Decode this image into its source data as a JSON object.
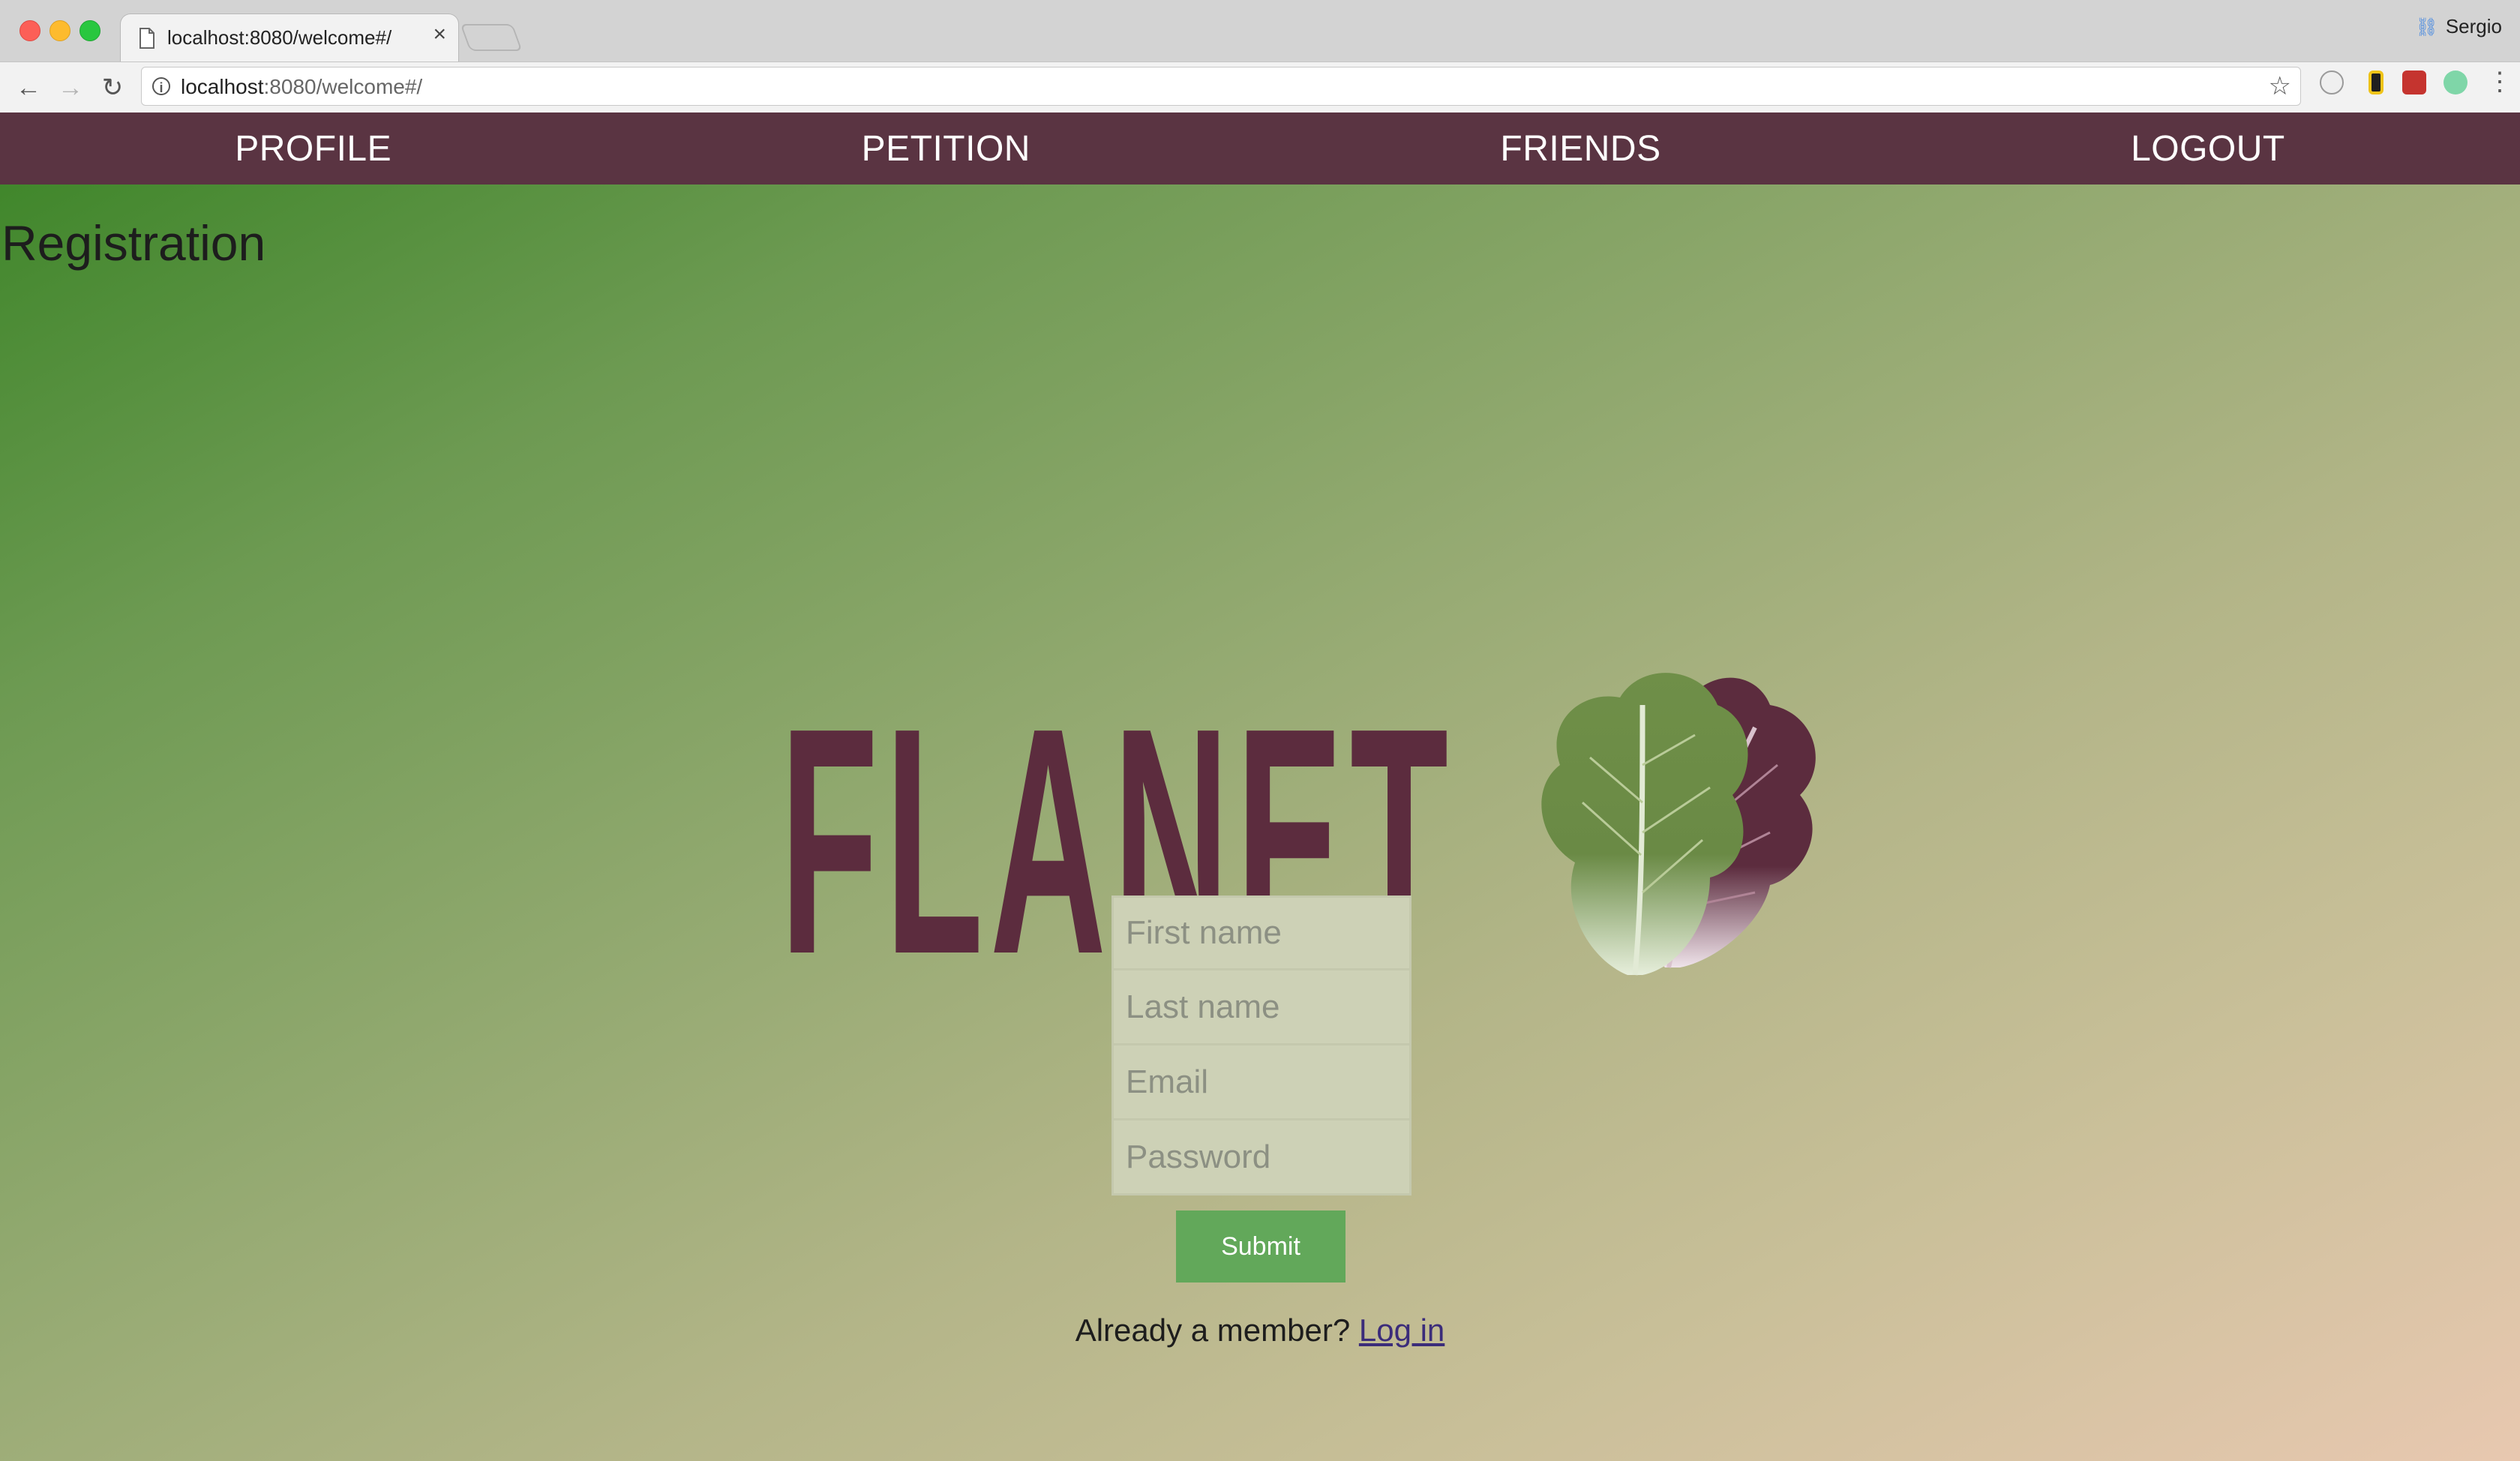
{
  "browser": {
    "tab_title": "localhost:8080/welcome#/",
    "tab_close": "×",
    "profile_name": "Sergio",
    "url_host": "localhost",
    "url_rest": ":8080/welcome#/"
  },
  "nav": {
    "items": [
      {
        "label": "PROFILE"
      },
      {
        "label": "PETITION"
      },
      {
        "label": "FRIENDS"
      },
      {
        "label": "LOGOUT"
      }
    ],
    "background": "#5a3442"
  },
  "page": {
    "heading": "Registration",
    "logo_text": "FLANET",
    "logo_color": "#5c2c3e"
  },
  "form": {
    "first_name_placeholder": "First name",
    "last_name_placeholder": "Last name",
    "email_placeholder": "Email",
    "password_placeholder": "Password",
    "submit_label": "Submit",
    "submit_color": "#62a85a"
  },
  "footer": {
    "already_member": "Already a member?",
    "login_link": "Log in"
  }
}
